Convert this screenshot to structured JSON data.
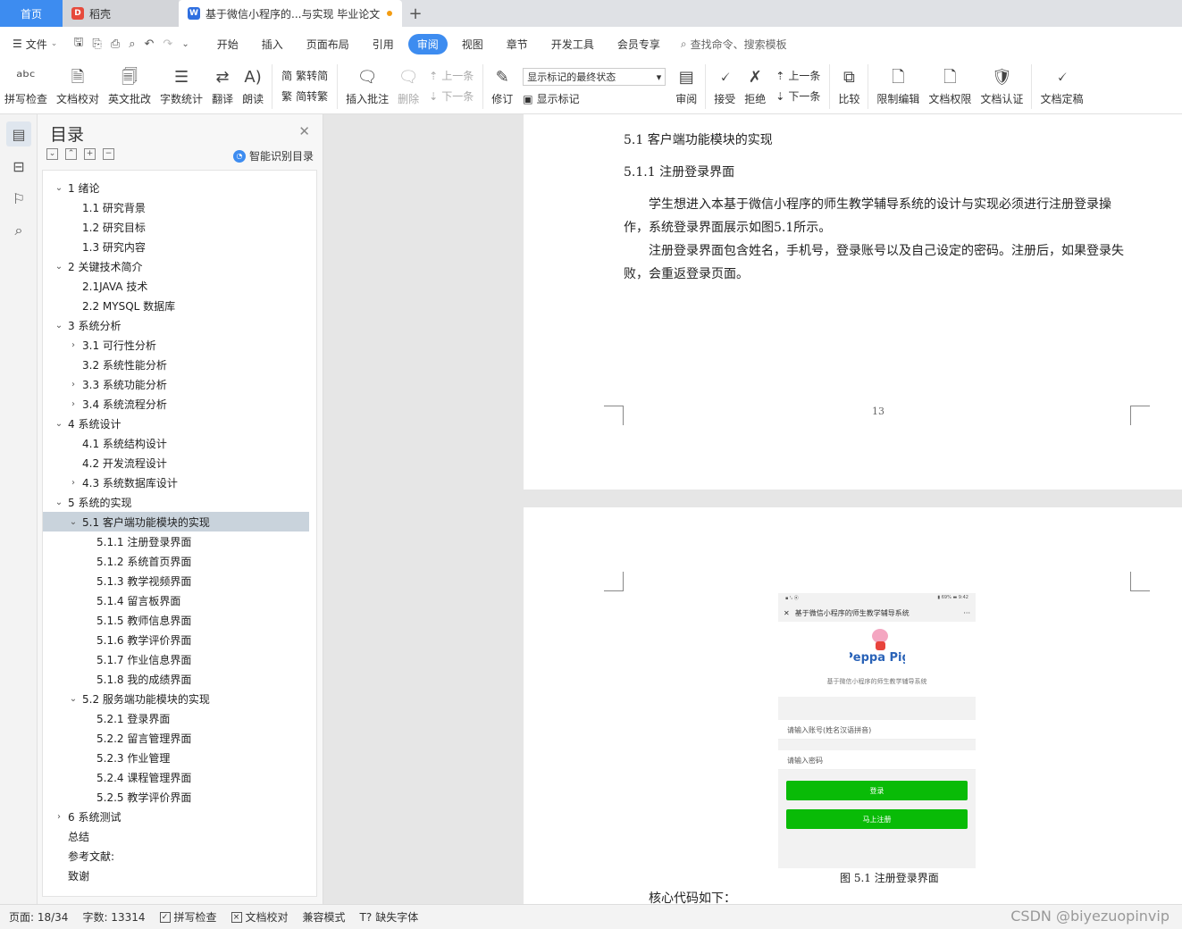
{
  "tabs": {
    "home": "首页",
    "daoke": "稻壳",
    "doc": "基于微信小程序的...与实现 毕业论文",
    "add": "+"
  },
  "menu": {
    "file": "文件",
    "tabs": [
      "开始",
      "插入",
      "页面布局",
      "引用",
      "审阅",
      "视图",
      "章节",
      "开发工具",
      "会员专享"
    ],
    "active_tab": "审阅",
    "search": "查找命令、搜索模板"
  },
  "ribbon": {
    "spell": "拼写检查",
    "proofread": "文档校对",
    "english": "英文批改",
    "wordcount": "字数统计",
    "translate": "翻译",
    "read": "朗读",
    "trad": "繁转简",
    "simp": "简转繁",
    "insert_comment": "插入批注",
    "delete": "删除",
    "prev": "上一条",
    "next": "下一条",
    "revise": "修订",
    "markup_state": "显示标记的最终状态",
    "show_markup": "显示标记",
    "review": "审阅",
    "accept": "接受",
    "reject": "拒绝",
    "prev2": "上一条",
    "next2": "下一条",
    "compare": "比较",
    "restrict": "限制编辑",
    "permission": "文档权限",
    "certify": "文档认证",
    "finalize": "文档定稿"
  },
  "toc": {
    "title": "目录",
    "smart": "智能识别目录",
    "items": [
      {
        "label": "1  绪论",
        "level": 0,
        "caret": "v"
      },
      {
        "label": "1.1 研究背景",
        "level": 1,
        "caret": ""
      },
      {
        "label": "1.2 研究目标",
        "level": 1,
        "caret": ""
      },
      {
        "label": "1.3 研究内容",
        "level": 1,
        "caret": ""
      },
      {
        "label": "2  关键技术简介",
        "level": 0,
        "caret": "v"
      },
      {
        "label": "2.1JAVA 技术",
        "level": 1,
        "caret": ""
      },
      {
        "label": "2.2 MYSQL 数据库",
        "level": 1,
        "caret": ""
      },
      {
        "label": "3  系统分析",
        "level": 0,
        "caret": "v"
      },
      {
        "label": "3.1 可行性分析",
        "level": 1,
        "caret": ">"
      },
      {
        "label": "3.2 系统性能分析",
        "level": 1,
        "caret": ""
      },
      {
        "label": "3.3 系统功能分析",
        "level": 1,
        "caret": ">"
      },
      {
        "label": "3.4 系统流程分析",
        "level": 1,
        "caret": ">"
      },
      {
        "label": "4  系统设计",
        "level": 0,
        "caret": "v"
      },
      {
        "label": "4.1 系统结构设计",
        "level": 1,
        "caret": ""
      },
      {
        "label": "4.2 开发流程设计",
        "level": 1,
        "caret": ""
      },
      {
        "label": "4.3 系统数据库设计",
        "level": 1,
        "caret": ">"
      },
      {
        "label": "5  系统的实现",
        "level": 0,
        "caret": "v"
      },
      {
        "label": "5.1 客户端功能模块的实现",
        "level": 1,
        "caret": "v"
      },
      {
        "label": "5.1.1 注册登录界面",
        "level": 2,
        "caret": ""
      },
      {
        "label": "5.1.2 系统首页界面",
        "level": 2,
        "caret": ""
      },
      {
        "label": "5.1.3 教学视频界面",
        "level": 2,
        "caret": ""
      },
      {
        "label": "5.1.4 留言板界面",
        "level": 2,
        "caret": ""
      },
      {
        "label": "5.1.5 教师信息界面",
        "level": 2,
        "caret": ""
      },
      {
        "label": "5.1.6 教学评价界面",
        "level": 2,
        "caret": ""
      },
      {
        "label": "5.1.7 作业信息界面",
        "level": 2,
        "caret": ""
      },
      {
        "label": "5.1.8 我的成绩界面",
        "level": 2,
        "caret": ""
      },
      {
        "label": "5.2 服务端功能模块的实现",
        "level": 1,
        "caret": "v"
      },
      {
        "label": "5.2.1 登录界面",
        "level": 2,
        "caret": ""
      },
      {
        "label": "5.2.2 留言管理界面",
        "level": 2,
        "caret": ""
      },
      {
        "label": "5.2.3 作业管理",
        "level": 2,
        "caret": ""
      },
      {
        "label": "5.2.4 课程管理界面",
        "level": 2,
        "caret": ""
      },
      {
        "label": "5.2.5 教学评价界面",
        "level": 2,
        "caret": ""
      },
      {
        "label": "6  系统测试",
        "level": 0,
        "caret": ">"
      },
      {
        "label": "总结",
        "level": 0,
        "caret": ""
      },
      {
        "label": "参考文献:",
        "level": 0,
        "caret": ""
      },
      {
        "label": "致谢",
        "level": 0,
        "caret": ""
      }
    ],
    "active_index": 17
  },
  "doc": {
    "h1": "5.1 客户端功能模块的实现",
    "h2": "5.1.1 注册登录界面",
    "p1": "学生想进入本基于微信小程序的师生教学辅导系统的设计与实现必须进行注册登录操作，系统登录界面展示如图5.1所示。",
    "p2": "注册登录界面包含姓名，手机号，登录账号以及自己设定的密码。注册后，如果登录失败，会重返登录页面。",
    "page_num": "13",
    "figure_caption": "图 5.1  注册登录界面",
    "code_intro": "核心代码如下：",
    "phone": {
      "status_left": "▪ ᵗᵢₗ ⦿",
      "status_right": "▮ 69% ▬ 9:42",
      "nav_title": "基于微信小程序的师生教学辅导系统",
      "nav_close": "✕",
      "nav_more": "···",
      "logo_text": "Peppa Pig",
      "app_name": "基于微信小程序的师生教学辅导系统",
      "account_placeholder": "请输入账号(姓名汉语拼音)",
      "password_placeholder": "请输入密码",
      "login_btn": "登录",
      "register_btn": "马上注册"
    }
  },
  "status": {
    "page": "页面: 18/34",
    "words": "字数: 13314",
    "spell": "拼写检查",
    "proof": "文档校对",
    "compat": "兼容模式",
    "missing_font": "缺失字体"
  },
  "watermark": "CSDN @biyezuopinvip",
  "colors": {
    "accent": "#3d8cf0",
    "wechat_green": "#09bb07",
    "toc_active": "#c9d3dc"
  }
}
